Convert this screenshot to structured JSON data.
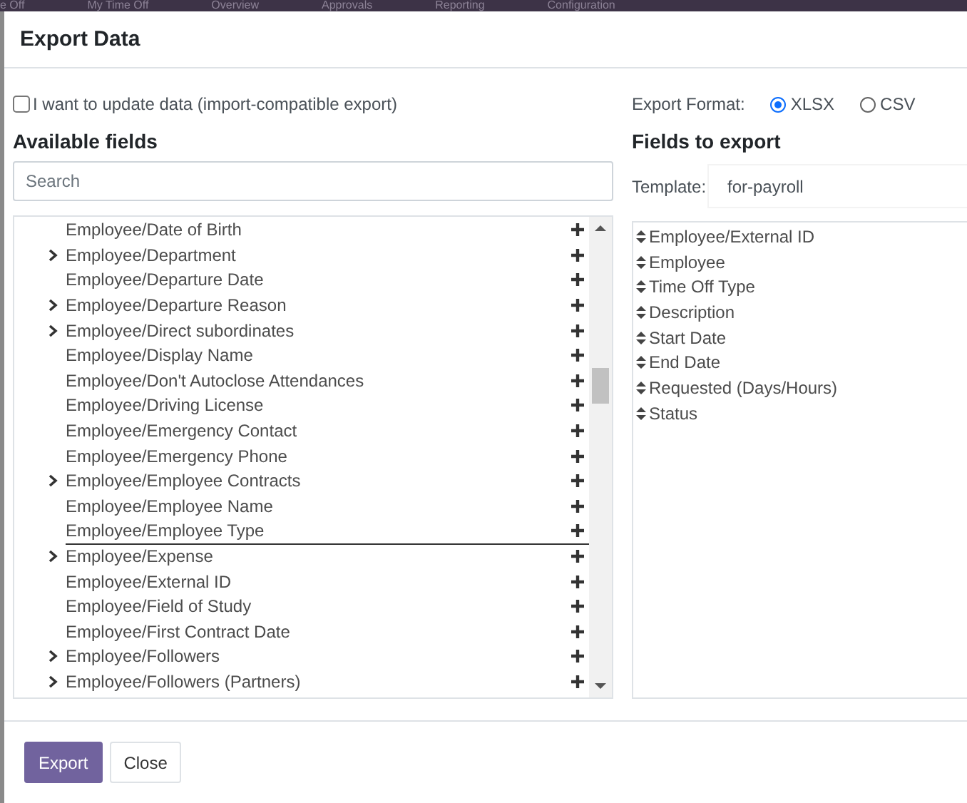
{
  "background_nav": [
    "e Off",
    "My Time Off",
    "Overview",
    "Approvals",
    "Reporting",
    "Configuration"
  ],
  "dialog": {
    "title": "Export Data"
  },
  "import_compatible": {
    "label": "I want to update data (import-compatible export)",
    "checked": false
  },
  "available_fields": {
    "heading": "Available fields",
    "search": {
      "placeholder": "Search"
    },
    "items": [
      {
        "label": "Employee/Date of Birth",
        "expandable": false,
        "drop_target": false
      },
      {
        "label": "Employee/Department",
        "expandable": true,
        "drop_target": false
      },
      {
        "label": "Employee/Departure Date",
        "expandable": false,
        "drop_target": false
      },
      {
        "label": "Employee/Departure Reason",
        "expandable": true,
        "drop_target": false
      },
      {
        "label": "Employee/Direct subordinates",
        "expandable": true,
        "drop_target": false
      },
      {
        "label": "Employee/Display Name",
        "expandable": false,
        "drop_target": false
      },
      {
        "label": "Employee/Don't Autoclose Attendances",
        "expandable": false,
        "drop_target": false
      },
      {
        "label": "Employee/Driving License",
        "expandable": false,
        "drop_target": false
      },
      {
        "label": "Employee/Emergency Contact",
        "expandable": false,
        "drop_target": false
      },
      {
        "label": "Employee/Emergency Phone",
        "expandable": false,
        "drop_target": false
      },
      {
        "label": "Employee/Employee Contracts",
        "expandable": true,
        "drop_target": false
      },
      {
        "label": "Employee/Employee Name",
        "expandable": false,
        "drop_target": false
      },
      {
        "label": "Employee/Employee Type",
        "expandable": false,
        "drop_target": true
      },
      {
        "label": "Employee/Expense",
        "expandable": true,
        "drop_target": false
      },
      {
        "label": "Employee/External ID",
        "expandable": false,
        "drop_target": false
      },
      {
        "label": "Employee/Field of Study",
        "expandable": false,
        "drop_target": false
      },
      {
        "label": "Employee/First Contract Date",
        "expandable": false,
        "drop_target": false
      },
      {
        "label": "Employee/Followers",
        "expandable": true,
        "drop_target": false
      },
      {
        "label": "Employee/Followers (Partners)",
        "expandable": true,
        "drop_target": false
      }
    ]
  },
  "export_format": {
    "label": "Export Format:",
    "options": [
      {
        "label": "XLSX",
        "selected": true
      },
      {
        "label": "CSV",
        "selected": false
      }
    ]
  },
  "fields_to_export": {
    "heading": "Fields to export",
    "template_label": "Template:",
    "template_value": "for-payroll",
    "items": [
      "Employee/External ID",
      "Employee",
      "Time Off Type",
      "Description",
      "Start Date",
      "End Date",
      "Requested (Days/Hours)",
      "Status"
    ]
  },
  "buttons": [
    {
      "label": "Export",
      "kind": "primary"
    },
    {
      "label": "Close",
      "kind": "secondary"
    }
  ]
}
